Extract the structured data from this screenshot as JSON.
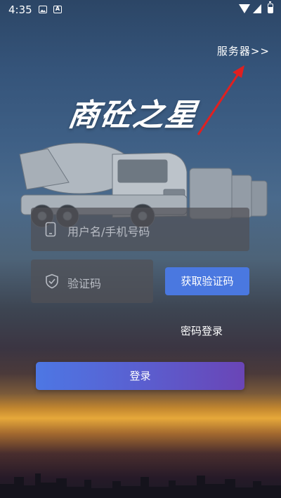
{
  "status_bar": {
    "time": "4:35",
    "icons": [
      "gallery-icon",
      "font-icon",
      "wifi-icon",
      "cell-signal-icon",
      "battery-icon"
    ]
  },
  "server": {
    "label": "服务器>>"
  },
  "app": {
    "logo_text": "商砼之星"
  },
  "form": {
    "username_placeholder": "用户名/手机号码",
    "code_placeholder": "验证码",
    "get_code_label": "获取验证码",
    "password_login_label": "密码登录",
    "login_label": "登录"
  },
  "colors": {
    "accent": "#4a78e0",
    "login_gradient_start": "#4d77e4",
    "login_gradient_end": "#6a45b6",
    "annotation_arrow": "#e02020"
  }
}
